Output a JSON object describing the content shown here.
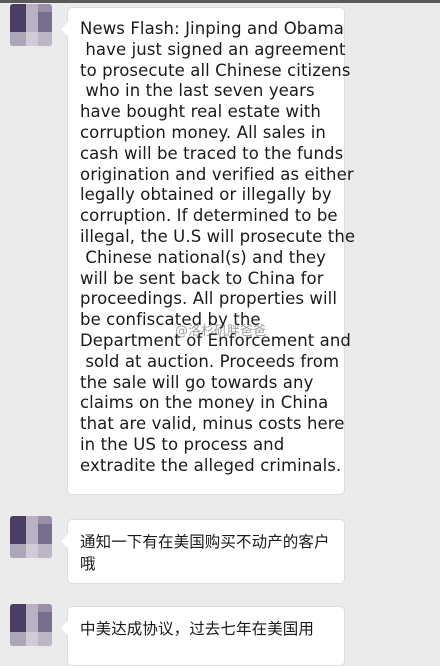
{
  "messages": [
    {
      "text": "News Flash: Jinping and Obama\n have just signed an agreement\nto prosecute all Chinese citizens\n who in the last seven years\nhave bought real estate with\ncorruption money. All sales in\ncash will be traced to the funds\norigination and verified as either\nlegally obtained or illegally by\ncorruption. If determined to be\nillegal, the U.S will prosecute the\n Chinese national(s) and they\nwill be sent back to China for\nproceedings. All properties will\nbe confiscated by the\nDepartment of Enforcement and\n sold at auction. Proceeds from\nthe sale will go towards any\nclaims on the money in China\nthat are valid, minus costs here\nin the US to process and\nextradite the alleged criminals."
    },
    {
      "text": "通知一下有在美国购买不动产的客户哦"
    },
    {
      "text": "中美达成协议，过去七年在美国用"
    }
  ],
  "watermark": "@洛杉矶胖爸爸"
}
